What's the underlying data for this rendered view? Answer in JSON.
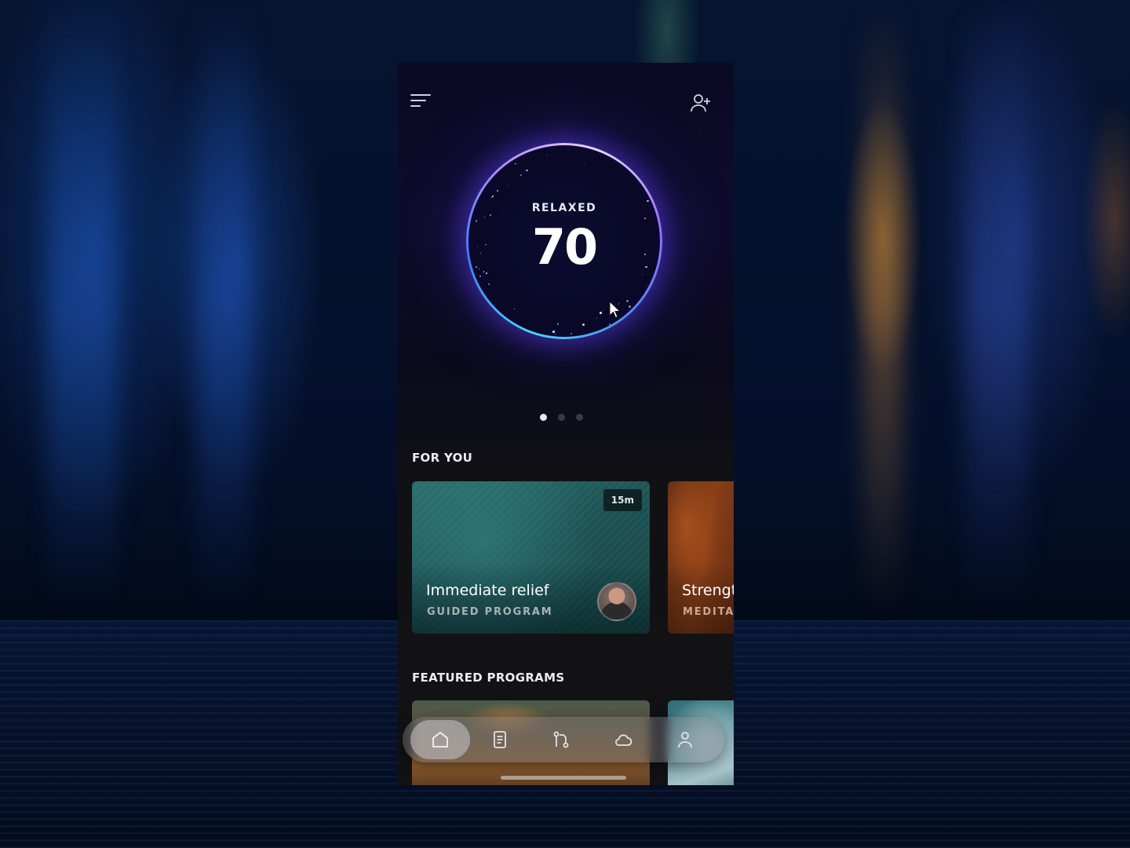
{
  "gauge": {
    "label": "RELAXED",
    "value": "70"
  },
  "carousel": {
    "pages": 3,
    "active_page": 1
  },
  "for_you": {
    "title": "FOR YOU",
    "cards": [
      {
        "duration": "15m",
        "title": "Immediate relief",
        "subtitle": "GUIDED PROGRAM"
      },
      {
        "title": "Strengt",
        "subtitle": "MEDITA"
      }
    ]
  },
  "featured": {
    "title": "FEATURED PROGRAMS"
  },
  "icons": {
    "menu": "menu-icon",
    "add_user": "add-user-icon",
    "nav": [
      "home-icon",
      "journal-icon",
      "path-icon",
      "cloud-icon",
      "profile-icon"
    ]
  },
  "colors": {
    "gauge_ring": "#7aa8ff",
    "accent_purple": "#b48cff",
    "nav_active": "#c8c8ce"
  }
}
